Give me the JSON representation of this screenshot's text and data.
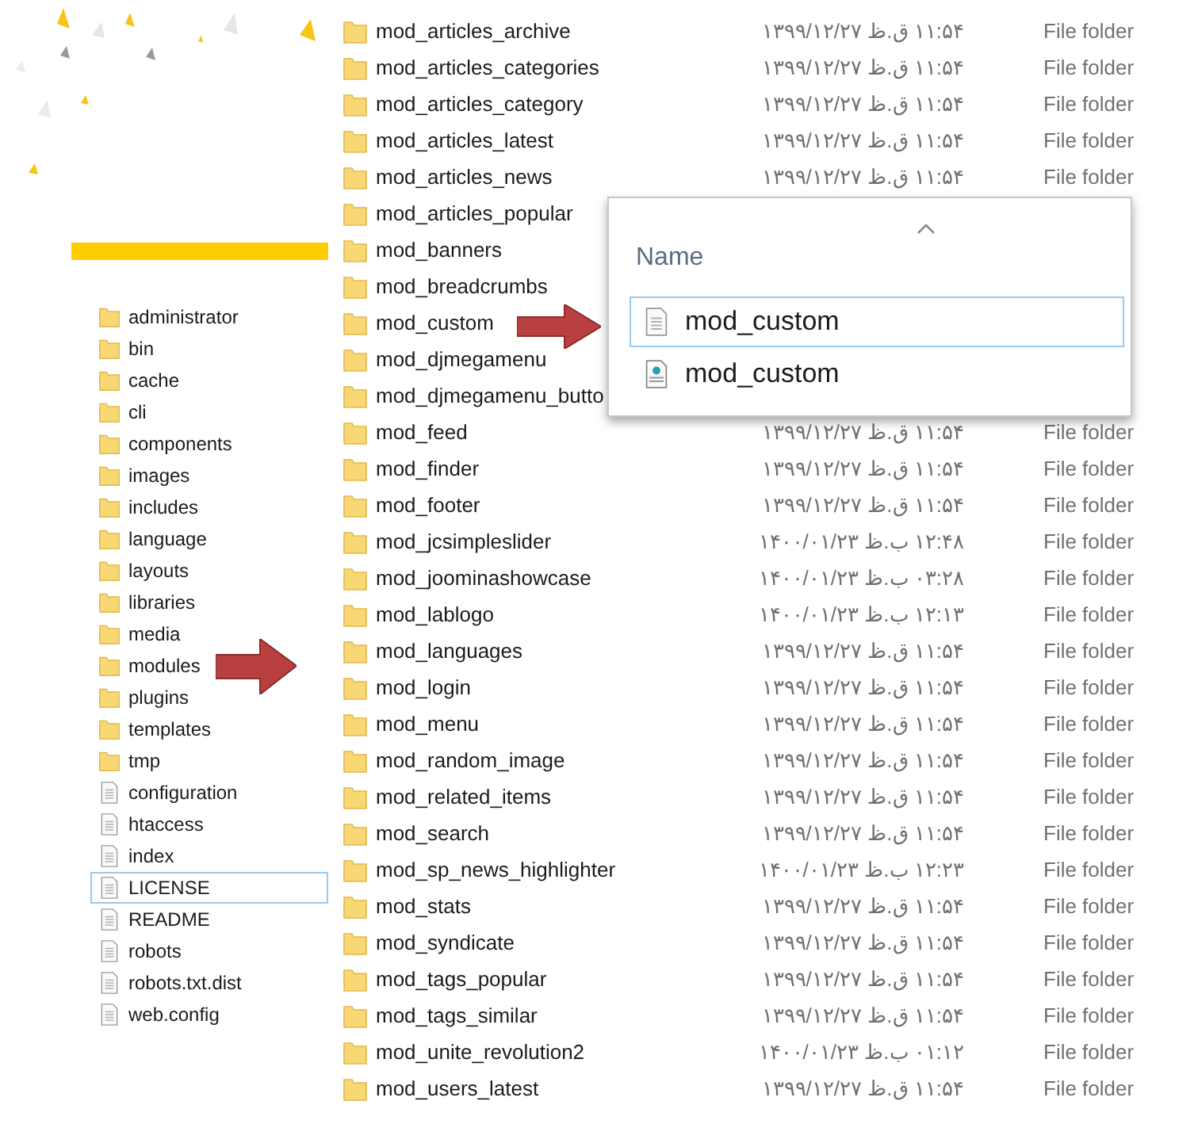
{
  "sidebar": {
    "items": [
      {
        "name": "administrator",
        "kind": "folder",
        "selected": false
      },
      {
        "name": "bin",
        "kind": "folder",
        "selected": false
      },
      {
        "name": "cache",
        "kind": "folder",
        "selected": false
      },
      {
        "name": "cli",
        "kind": "folder",
        "selected": false
      },
      {
        "name": "components",
        "kind": "folder",
        "selected": false
      },
      {
        "name": "images",
        "kind": "folder",
        "selected": false
      },
      {
        "name": "includes",
        "kind": "folder",
        "selected": false
      },
      {
        "name": "language",
        "kind": "folder",
        "selected": false
      },
      {
        "name": "layouts",
        "kind": "folder",
        "selected": false
      },
      {
        "name": "libraries",
        "kind": "folder",
        "selected": false
      },
      {
        "name": "media",
        "kind": "folder",
        "selected": false
      },
      {
        "name": "modules",
        "kind": "folder",
        "selected": false
      },
      {
        "name": "plugins",
        "kind": "folder",
        "selected": false
      },
      {
        "name": "templates",
        "kind": "folder",
        "selected": false
      },
      {
        "name": "tmp",
        "kind": "folder",
        "selected": false
      },
      {
        "name": "configuration",
        "kind": "file",
        "selected": false
      },
      {
        "name": "htaccess",
        "kind": "file",
        "selected": false
      },
      {
        "name": "index",
        "kind": "file",
        "selected": false
      },
      {
        "name": "LICENSE",
        "kind": "file",
        "selected": true
      },
      {
        "name": "README",
        "kind": "file",
        "selected": false
      },
      {
        "name": "robots",
        "kind": "file",
        "selected": false
      },
      {
        "name": "robots.txt.dist",
        "kind": "file",
        "selected": false
      },
      {
        "name": "web.config",
        "kind": "file",
        "selected": false
      }
    ]
  },
  "files": {
    "rows": [
      {
        "name": "mod_articles_archive",
        "modified": "۱۱:۵۴ ق.ظ ۱۳۹۹/۱۲/۲۷",
        "type": "File folder"
      },
      {
        "name": "mod_articles_categories",
        "modified": "۱۱:۵۴ ق.ظ ۱۳۹۹/۱۲/۲۷",
        "type": "File folder"
      },
      {
        "name": "mod_articles_category",
        "modified": "۱۱:۵۴ ق.ظ ۱۳۹۹/۱۲/۲۷",
        "type": "File folder"
      },
      {
        "name": "mod_articles_latest",
        "modified": "۱۱:۵۴ ق.ظ ۱۳۹۹/۱۲/۲۷",
        "type": "File folder"
      },
      {
        "name": "mod_articles_news",
        "modified": "۱۱:۵۴ ق.ظ ۱۳۹۹/۱۲/۲۷",
        "type": "File folder"
      },
      {
        "name": "mod_articles_popular"
      },
      {
        "name": "mod_banners"
      },
      {
        "name": "mod_breadcrumbs"
      },
      {
        "name": "mod_custom"
      },
      {
        "name": "mod_djmegamenu"
      },
      {
        "name": "mod_djmegamenu_butto"
      },
      {
        "name": "mod_feed",
        "modified": "۱۱:۵۴ ق.ظ ۱۳۹۹/۱۲/۲۷",
        "type": "File folder"
      },
      {
        "name": "mod_finder",
        "modified": "۱۱:۵۴ ق.ظ ۱۳۹۹/۱۲/۲۷",
        "type": "File folder"
      },
      {
        "name": "mod_footer",
        "modified": "۱۱:۵۴ ق.ظ ۱۳۹۹/۱۲/۲۷",
        "type": "File folder"
      },
      {
        "name": "mod_jcsimpleslider",
        "modified": "۱۲:۴۸ ب.ظ ۱۴۰۰/۰۱/۲۳",
        "type": "File folder"
      },
      {
        "name": "mod_joominashowcase",
        "modified": "۰۳:۲۸ ب.ظ ۱۴۰۰/۰۱/۲۳",
        "type": "File folder"
      },
      {
        "name": "mod_lablogo",
        "modified": "۱۲:۱۳ ب.ظ ۱۴۰۰/۰۱/۲۳",
        "type": "File folder"
      },
      {
        "name": "mod_languages",
        "modified": "۱۱:۵۴ ق.ظ ۱۳۹۹/۱۲/۲۷",
        "type": "File folder"
      },
      {
        "name": "mod_login",
        "modified": "۱۱:۵۴ ق.ظ ۱۳۹۹/۱۲/۲۷",
        "type": "File folder"
      },
      {
        "name": "mod_menu",
        "modified": "۱۱:۵۴ ق.ظ ۱۳۹۹/۱۲/۲۷",
        "type": "File folder"
      },
      {
        "name": "mod_random_image",
        "modified": "۱۱:۵۴ ق.ظ ۱۳۹۹/۱۲/۲۷",
        "type": "File folder"
      },
      {
        "name": "mod_related_items",
        "modified": "۱۱:۵۴ ق.ظ ۱۳۹۹/۱۲/۲۷",
        "type": "File folder"
      },
      {
        "name": "mod_search",
        "modified": "۱۱:۵۴ ق.ظ ۱۳۹۹/۱۲/۲۷",
        "type": "File folder"
      },
      {
        "name": "mod_sp_news_highlighter",
        "modified": "۱۲:۲۳ ب.ظ ۱۴۰۰/۰۱/۲۳",
        "type": "File folder"
      },
      {
        "name": "mod_stats",
        "modified": "۱۱:۵۴ ق.ظ ۱۳۹۹/۱۲/۲۷",
        "type": "File folder"
      },
      {
        "name": "mod_syndicate",
        "modified": "۱۱:۵۴ ق.ظ ۱۳۹۹/۱۲/۲۷",
        "type": "File folder"
      },
      {
        "name": "mod_tags_popular",
        "modified": "۱۱:۵۴ ق.ظ ۱۳۹۹/۱۲/۲۷",
        "type": "File folder"
      },
      {
        "name": "mod_tags_similar",
        "modified": "۱۱:۵۴ ق.ظ ۱۳۹۹/۱۲/۲۷",
        "type": "File folder"
      },
      {
        "name": "mod_unite_revolution2",
        "modified": "۰۱:۱۲ ب.ظ ۱۴۰۰/۰۱/۲۳",
        "type": "File folder"
      },
      {
        "name": "mod_users_latest",
        "modified": "۱۱:۵۴ ق.ظ ۱۳۹۹/۱۲/۲۷",
        "type": "File folder"
      }
    ]
  },
  "popup": {
    "column": "Name",
    "items": [
      {
        "name": "mod_custom",
        "kind": "text-file",
        "selected": true
      },
      {
        "name": "mod_custom",
        "kind": "config-file",
        "selected": false
      }
    ]
  }
}
